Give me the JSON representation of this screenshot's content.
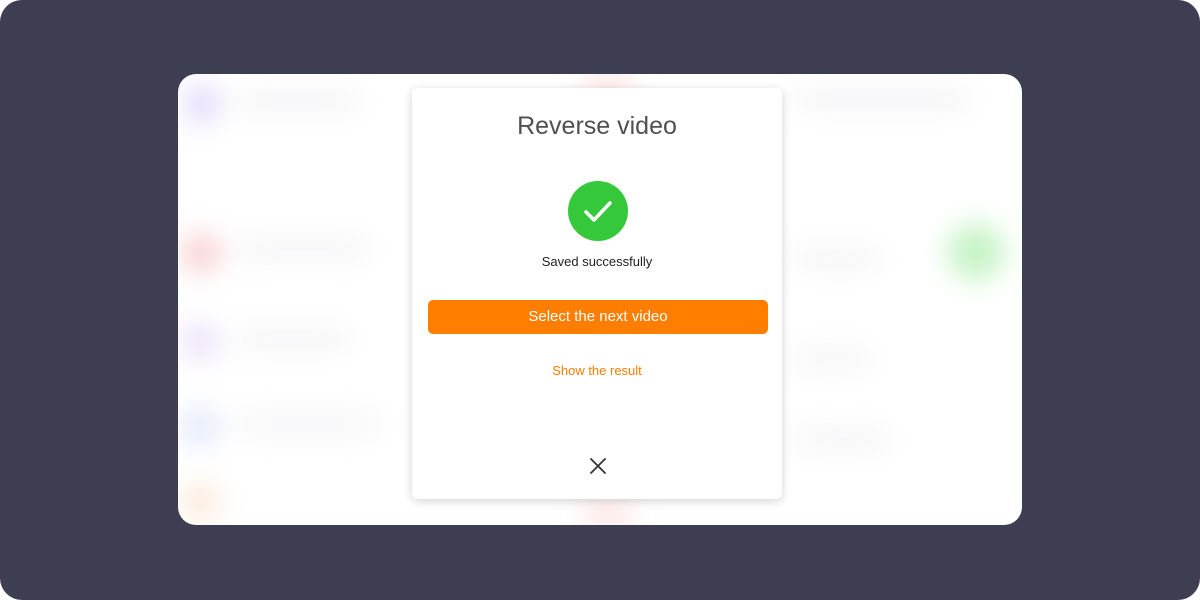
{
  "dialog": {
    "title": "Reverse video",
    "status_icon": "check-circle-icon",
    "status_text": "Saved successfully",
    "primary_button_label": "Select the next video",
    "secondary_link_label": "Show the result",
    "close_icon": "close-icon"
  },
  "colors": {
    "frame_background": "#3e3e52",
    "accent": "#ff7e00",
    "success": "#34c83a"
  }
}
